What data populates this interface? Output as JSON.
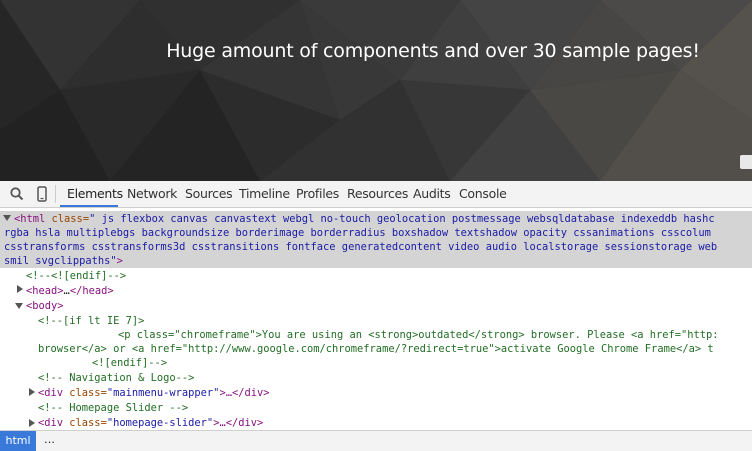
{
  "hero": {
    "text": "Huge amount of components and over 30 sample pages!"
  },
  "toolbar": {
    "tabs": [
      {
        "label": "Elements"
      },
      {
        "label": "Network"
      },
      {
        "label": "Sources"
      },
      {
        "label": "Timeline"
      },
      {
        "label": "Profiles"
      },
      {
        "label": "Resources"
      },
      {
        "label": "Audits"
      },
      {
        "label": "Console"
      }
    ],
    "icons": [
      "search-icon",
      "device-mode-icon"
    ]
  },
  "tree": {
    "html_open": {
      "tag": "<html",
      "attr": " class=",
      "value": "\" js flexbox canvas canvastext webgl no-touch geolocation postmessage websqldatabase indexeddb hashc"
    },
    "html_wrap_1": "rgba hsla multiplebgs backgroundsize borderimage borderradius boxshadow textshadow opacity cssanimations csscolum",
    "html_wrap_2": "csstransforms csstransforms3d csstransitions fontface generatedcontent video audio localstorage sessionstorage web",
    "html_wrap_3_value": "smil svgclippaths\"",
    "html_wrap_3_close": ">",
    "comment_endif": "<!--<![endif]-->",
    "head": {
      "open": "<head>",
      "ellipsis": "…",
      "close": "</head>"
    },
    "body_open": "<body>",
    "comment_if_ie": "<!--[if lt IE 7]>",
    "chromeframe_line1": "<p class=\"chromeframe\">You are using an <strong>outdated</strong> browser. Please <a href=\"http:",
    "chromeframe_line2": "browser</a> or <a href=\"http://www.google.com/chromeframe/?redirect=true\">activate Google Chrome Frame</a> t",
    "endif_close": "<![endif]-->",
    "comment_nav": "<!-- Navigation & Logo-->",
    "div_menu": {
      "open": "<div",
      "attr": " class=",
      "value": "\"mainmenu-wrapper\"",
      "rest": ">…</div>"
    },
    "comment_slider": "<!-- Homepage Slider -->",
    "div_slider": {
      "open": "<div",
      "attr": " class=",
      "value": "\"homepage-slider\"",
      "rest": ">…</div>"
    }
  },
  "breadcrumb": {
    "current": "html",
    "more": "…"
  }
}
